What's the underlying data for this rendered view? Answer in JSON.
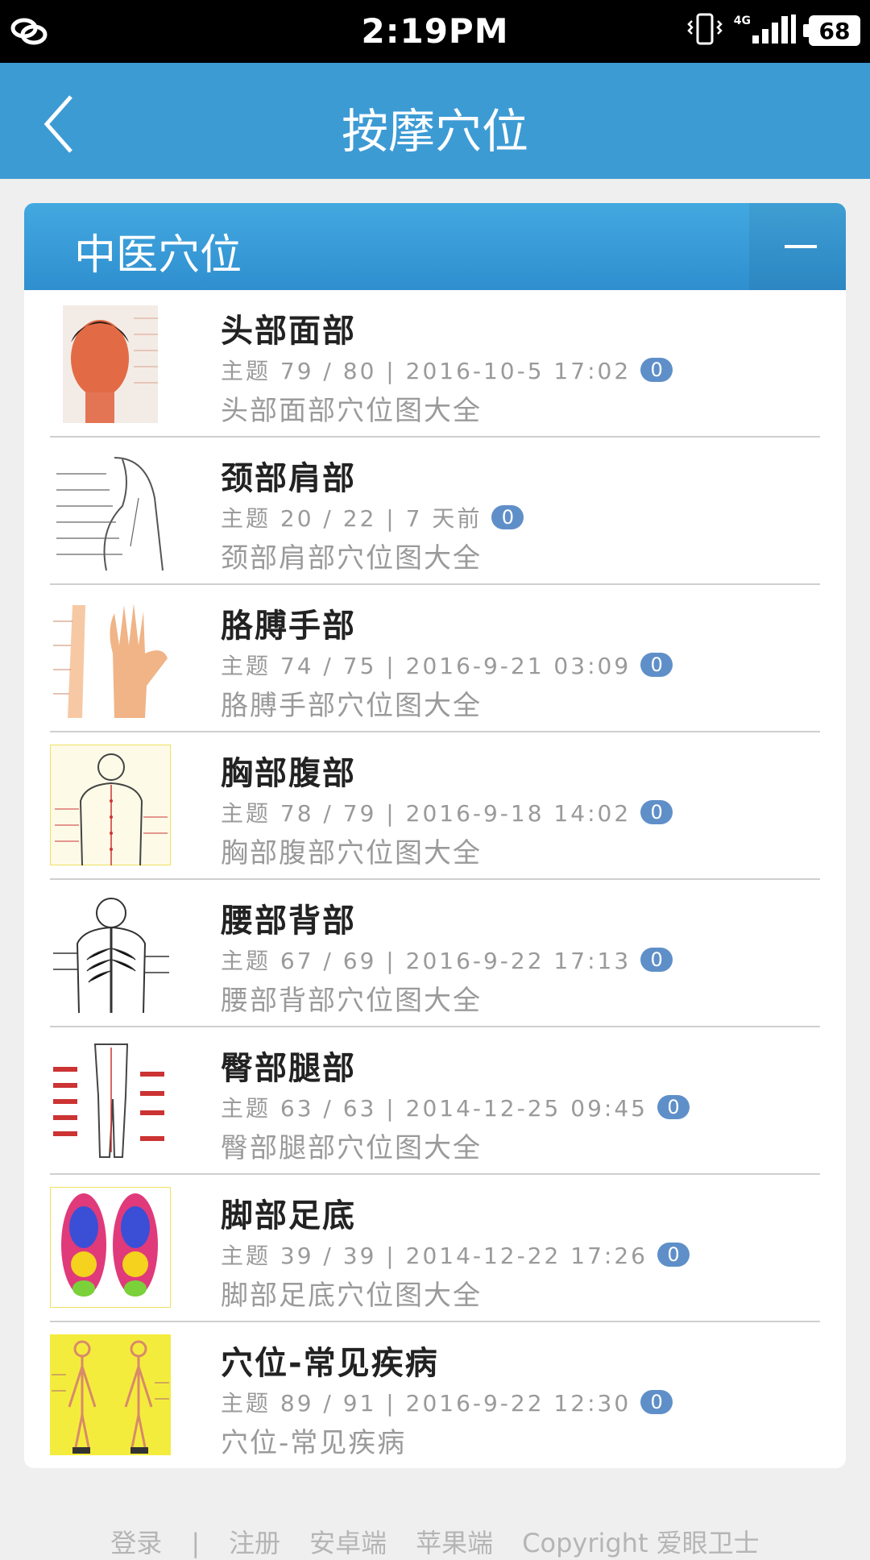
{
  "status_bar": {
    "time": "2:19PM",
    "network": "4G",
    "battery": "68",
    "icons": [
      "app-link-icon",
      "vibrate-icon",
      "signal-icon",
      "battery-icon"
    ]
  },
  "header": {
    "title": "按摩穴位",
    "back_icon": "chevron-left-icon"
  },
  "panel": {
    "title": "中医穴位",
    "collapse_icon": "minus-icon",
    "items": [
      {
        "name": "头部面部",
        "meta": "主题 79 / 80 | 2016-10-5 17:02",
        "badge": "0",
        "desc": "头部面部穴位图大全",
        "thumb": "head-acupoint-thumbnail"
      },
      {
        "name": "颈部肩部",
        "meta": "主题 20 / 22 | 7 天前",
        "badge": "0",
        "desc": "颈部肩部穴位图大全",
        "thumb": "neck-shoulder-acupoint-thumbnail"
      },
      {
        "name": "胳膊手部",
        "meta": "主题 74 / 75 | 2016-9-21 03:09",
        "badge": "0",
        "desc": "胳膊手部穴位图大全",
        "thumb": "arm-hand-acupoint-thumbnail"
      },
      {
        "name": "胸部腹部",
        "meta": "主题 78 / 79 | 2016-9-18 14:02",
        "badge": "0",
        "desc": "胸部腹部穴位图大全",
        "thumb": "chest-abdomen-acupoint-thumbnail"
      },
      {
        "name": "腰部背部",
        "meta": "主题 67 / 69 | 2016-9-22 17:13",
        "badge": "0",
        "desc": "腰部背部穴位图大全",
        "thumb": "back-acupoint-thumbnail"
      },
      {
        "name": "臀部腿部",
        "meta": "主题 63 / 63 | 2014-12-25 09:45",
        "badge": "0",
        "desc": "臀部腿部穴位图大全",
        "thumb": "leg-acupoint-thumbnail"
      },
      {
        "name": "脚部足底",
        "meta": "主题 39 / 39 | 2014-12-22 17:26",
        "badge": "0",
        "desc": "脚部足底穴位图大全",
        "thumb": "foot-sole-acupoint-thumbnail"
      },
      {
        "name": "穴位-常见疾病",
        "meta": "主题 89 / 91 | 2016-9-22 12:30",
        "badge": "0",
        "desc": "穴位-常见疾病",
        "thumb": "common-disease-acupoint-thumbnail"
      }
    ]
  },
  "footer": {
    "login": "登录",
    "sep": "|",
    "register": "注册",
    "android": "安卓端",
    "ios": "苹果端",
    "copyright": "Copyright 爱眼卫士"
  },
  "colors": {
    "header_bg": "#3d9bd4",
    "badge_bg": "#5f8fc8",
    "page_bg": "#efefef"
  }
}
